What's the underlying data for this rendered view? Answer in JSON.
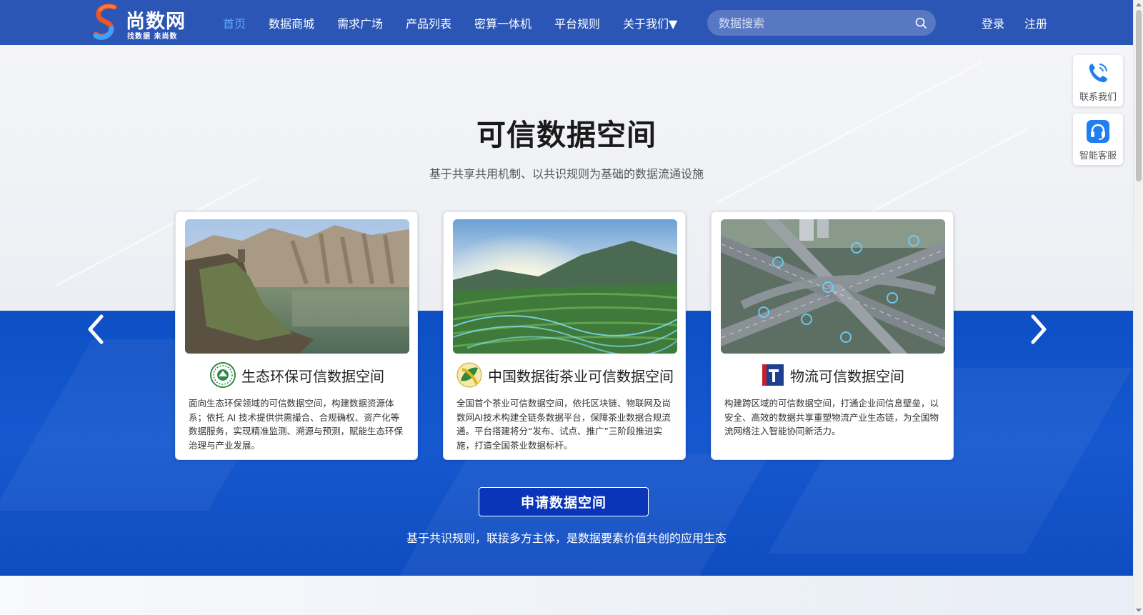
{
  "header": {
    "logo_title": "尚数网",
    "logo_slogan": "找数据 来尚数",
    "nav": [
      {
        "label": "首页",
        "active": true
      },
      {
        "label": "数据商城"
      },
      {
        "label": "需求广场"
      },
      {
        "label": "产品列表"
      },
      {
        "label": "密算一体机"
      },
      {
        "label": "平台规则"
      },
      {
        "label": "关于我们▼"
      }
    ],
    "search_placeholder": "数据搜索",
    "login": "登录",
    "register": "注册"
  },
  "hero": {
    "title": "可信数据空间",
    "subtitle": "基于共享共用机制、以共识规则为基础的数据流通设施"
  },
  "cards": [
    {
      "title": "生态环保可信数据空间",
      "desc": "面向生态环保领域的可信数据空间，构建数据资源体系；依托 AI 技术提供供需撮合、合规确权、资产化等数据服务，实现精准监测、溯源与预测，赋能生态环保治理与产业发展。"
    },
    {
      "title": "中国数据街茶业可信数据空间",
      "desc": "全国首个茶业可信数据空间，依托区块链、物联网及尚数网AI技术构建全链条数据平台，保障茶业数据合规流通。平台搭建将分“发布、试点、推广”三阶段推进实施，打造全国茶业数据标杆。"
    },
    {
      "title": "物流可信数据空间",
      "desc": "构建跨区域的可信数据空间，打通企业间信息壁垒，以安全、高效的数据共享重塑物流产业生态链，为全国物流网络注入智能协同新活力。"
    }
  ],
  "cta": {
    "button": "申请数据空间",
    "text": "基于共识规则，联接多方主体，是数据要素价值共创的应用生态"
  },
  "float_buttons": {
    "contact": "联系我们",
    "service": "智能客服"
  },
  "colors": {
    "header_bg": "#2b56b5",
    "nav_active": "#5aa8ff",
    "hero_blue": "#1658cf",
    "cta_button": "#0b35b8"
  }
}
